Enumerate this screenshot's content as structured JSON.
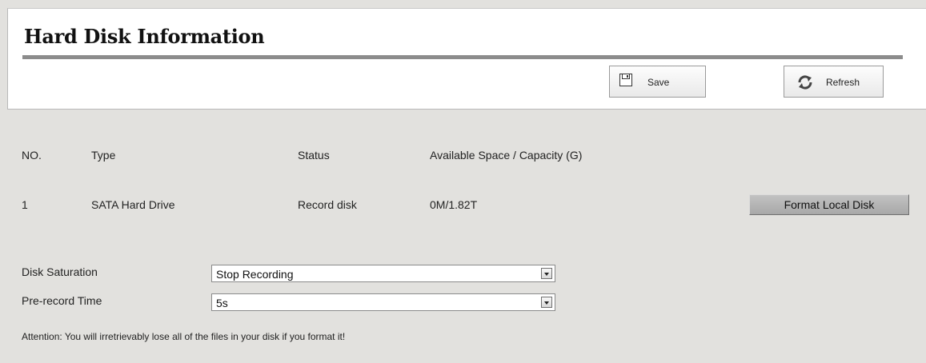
{
  "page": {
    "title": "Hard Disk Information"
  },
  "toolbar": {
    "save_label": "Save",
    "refresh_label": "Refresh"
  },
  "disk_table": {
    "headers": {
      "no": "NO.",
      "type": "Type",
      "status": "Status",
      "space": "Available Space / Capacity (G)"
    },
    "rows": [
      {
        "no": "1",
        "type": "SATA Hard Drive",
        "status": "Record disk",
        "space": "0M/1.82T"
      }
    ],
    "format_label": "Format Local Disk"
  },
  "settings": {
    "disk_saturation": {
      "label": "Disk Saturation",
      "value": "Stop Recording"
    },
    "pre_record_time": {
      "label": "Pre-record Time",
      "value": "5s"
    }
  },
  "attention": "Attention: You will irretrievably lose all of the files in your disk if you format it!"
}
